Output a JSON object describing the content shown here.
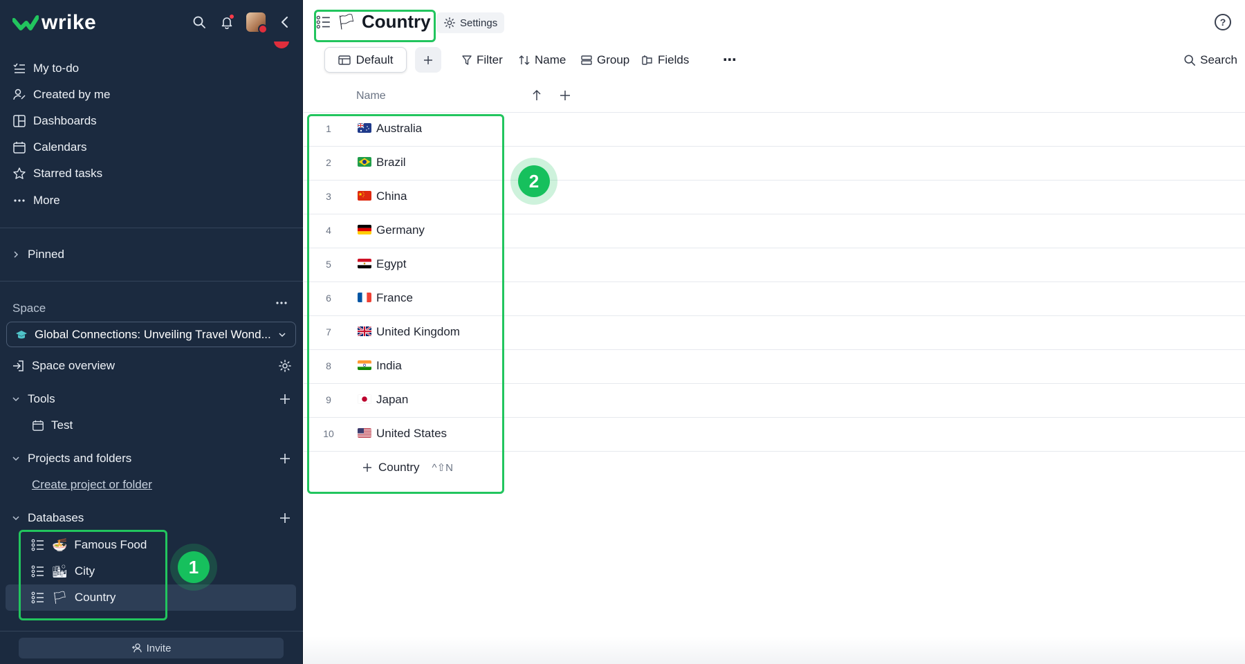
{
  "app": {
    "logo_text": "wrike"
  },
  "sidebar": {
    "nav": [
      {
        "label": "My to-do",
        "icon": "todo-icon"
      },
      {
        "label": "Created by me",
        "icon": "user-pen-icon"
      },
      {
        "label": "Dashboards",
        "icon": "dashboard-icon"
      },
      {
        "label": "Calendars",
        "icon": "calendar-icon"
      },
      {
        "label": "Starred tasks",
        "icon": "star-icon"
      },
      {
        "label": "More",
        "icon": "more-dots-icon"
      }
    ],
    "pinned_label": "Pinned",
    "space_label": "Space",
    "space_selector": "Global Connections: Unveiling Travel Wond...",
    "space_overview": "Space overview",
    "tools": {
      "label": "Tools",
      "items": [
        "Test"
      ]
    },
    "projects": {
      "label": "Projects and folders",
      "create_link": "Create project or folder"
    },
    "databases": {
      "label": "Databases",
      "items": [
        {
          "emoji": "🍜",
          "label": "Famous Food"
        },
        {
          "emoji": "🏙",
          "label": "City"
        },
        {
          "emoji": "🏳",
          "label": "Country",
          "active": true
        }
      ]
    },
    "invite_label": "Invite"
  },
  "header": {
    "emoji": "🏳",
    "title": "Country",
    "settings_label": "Settings",
    "help_icon": "?"
  },
  "toolbar": {
    "view_label": "Default",
    "filter_label": "Filter",
    "sort_label": "Name",
    "group_label": "Group",
    "fields_label": "Fields",
    "more_label": "⋯",
    "search_label": "Search"
  },
  "table": {
    "column_name": "Name",
    "rows": [
      {
        "num": "1",
        "name": "Australia",
        "flag": "au"
      },
      {
        "num": "2",
        "name": "Brazil",
        "flag": "br"
      },
      {
        "num": "3",
        "name": "China",
        "flag": "cn"
      },
      {
        "num": "4",
        "name": "Germany",
        "flag": "de"
      },
      {
        "num": "5",
        "name": "Egypt",
        "flag": "eg"
      },
      {
        "num": "6",
        "name": "France",
        "flag": "fr"
      },
      {
        "num": "7",
        "name": "United Kingdom",
        "flag": "gb"
      },
      {
        "num": "8",
        "name": "India",
        "flag": "in"
      },
      {
        "num": "9",
        "name": "Japan",
        "flag": "jp"
      },
      {
        "num": "10",
        "name": "United States",
        "flag": "us"
      }
    ],
    "add_row_label": "Country",
    "add_row_shortcut": "^⇧N"
  },
  "annotations": [
    {
      "num": "1"
    },
    {
      "num": "2"
    }
  ],
  "colors": {
    "sidebar_bg": "#1b2a3f",
    "highlight": "#22c55e",
    "active_item": "#2d3e56"
  }
}
